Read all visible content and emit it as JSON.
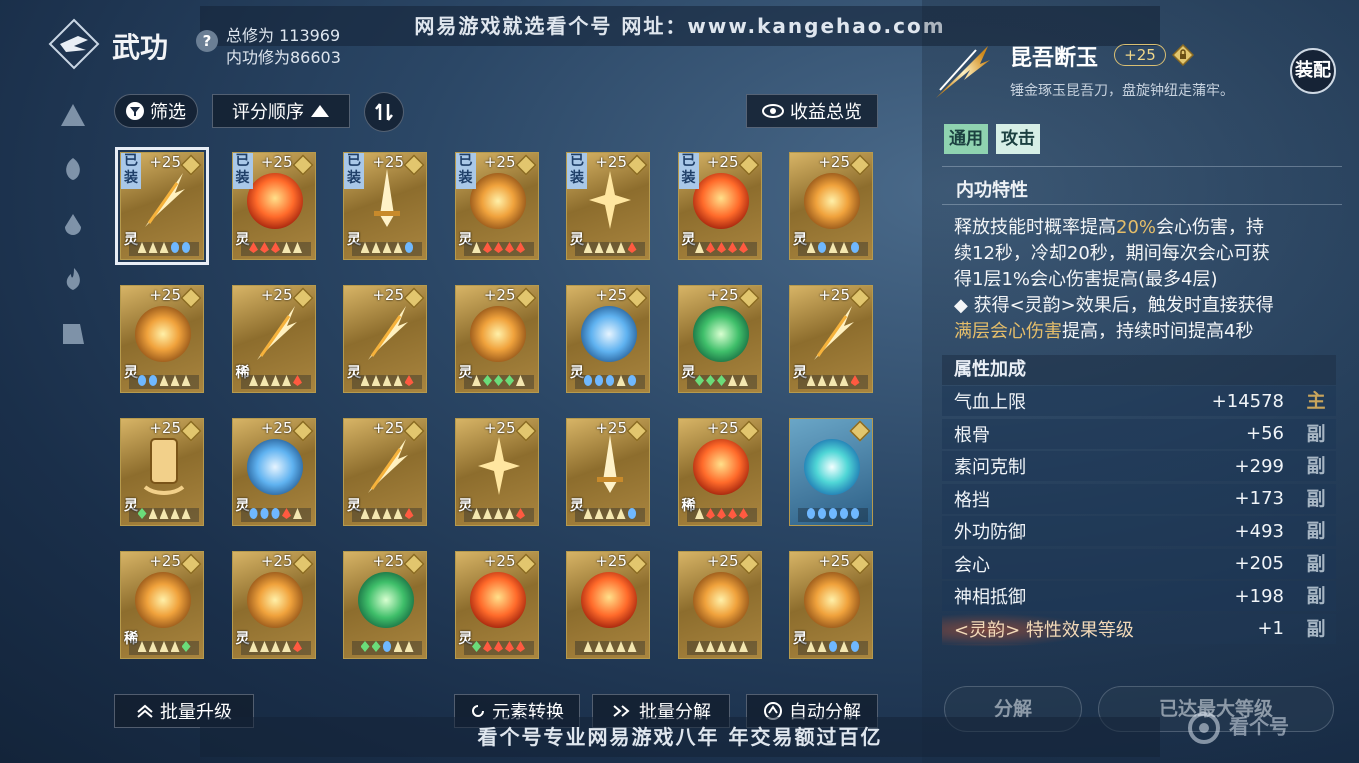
{
  "watermark_top": "网易游戏就选看个号  网址：www.kangehao.com",
  "watermark_bottom": "看个号专业网易游戏八年  年交易额过百亿",
  "header": {
    "title": "武功",
    "help": "?",
    "total_cultivation": "总修为 113969",
    "inner_cultivation": "内功修为86603"
  },
  "toolbar": {
    "filter_label": "筛选",
    "sort_label": "评分顺序",
    "overview_label": "收益总览"
  },
  "bottom_bar": {
    "batch_upgrade": "批量升级",
    "element_convert": "元素转换",
    "batch_disassemble": "批量分解",
    "auto_disassemble": "自动分解"
  },
  "colors": {
    "accent_gold": "#e5be6a",
    "card_gold": "#b69a4d",
    "equipped_badge": "#a9c8e8"
  },
  "cards": [
    {
      "level": "+25",
      "rarity": "灵",
      "equipped": "已装",
      "selected": true,
      "art": "spear",
      "gems": [
        "w",
        "w",
        "w",
        "b",
        "b"
      ]
    },
    {
      "level": "+25",
      "rarity": "灵",
      "equipped": "已装",
      "art": "fire",
      "gems": [
        "r",
        "r",
        "r",
        "w",
        "w"
      ]
    },
    {
      "level": "+25",
      "rarity": "灵",
      "equipped": "已装",
      "art": "sword",
      "gems": [
        "w",
        "w",
        "w",
        "w",
        "b"
      ]
    },
    {
      "level": "+25",
      "rarity": "灵",
      "equipped": "已装",
      "art": "sun",
      "gems": [
        "w",
        "r",
        "r",
        "r",
        "r"
      ]
    },
    {
      "level": "+25",
      "rarity": "灵",
      "equipped": "已装",
      "art": "star",
      "gems": [
        "w",
        "w",
        "w",
        "w",
        "r"
      ]
    },
    {
      "level": "+25",
      "rarity": "灵",
      "equipped": "已装",
      "art": "fire",
      "gems": [
        "w",
        "r",
        "r",
        "r",
        "r"
      ]
    },
    {
      "level": "+25",
      "rarity": "灵",
      "equipped": "",
      "art": "sun",
      "gems": [
        "w",
        "b",
        "w",
        "w",
        "b"
      ]
    },
    {
      "level": "+25",
      "rarity": "灵",
      "equipped": "",
      "art": "sun",
      "gems": [
        "b",
        "b",
        "w",
        "w",
        "w"
      ]
    },
    {
      "level": "+25",
      "rarity": "稀",
      "equipped": "",
      "art": "spear",
      "gems": [
        "w",
        "w",
        "w",
        "w",
        "r"
      ]
    },
    {
      "level": "+25",
      "rarity": "灵",
      "equipped": "",
      "art": "spear",
      "gems": [
        "w",
        "w",
        "w",
        "w",
        "r"
      ]
    },
    {
      "level": "+25",
      "rarity": "灵",
      "equipped": "",
      "art": "sun",
      "gems": [
        "w",
        "g",
        "g",
        "g",
        "w"
      ]
    },
    {
      "level": "+25",
      "rarity": "灵",
      "equipped": "",
      "art": "water",
      "gems": [
        "b",
        "b",
        "b",
        "w",
        "b"
      ]
    },
    {
      "level": "+25",
      "rarity": "灵",
      "equipped": "",
      "art": "jade",
      "gems": [
        "g",
        "g",
        "g",
        "w",
        "w"
      ]
    },
    {
      "level": "+25",
      "rarity": "灵",
      "equipped": "",
      "art": "spear",
      "gems": [
        "w",
        "w",
        "w",
        "w",
        "r"
      ]
    },
    {
      "level": "+25",
      "rarity": "灵",
      "equipped": "",
      "art": "bell",
      "gems": [
        "g",
        "w",
        "w",
        "w",
        "w"
      ]
    },
    {
      "level": "+25",
      "rarity": "灵",
      "equipped": "",
      "art": "water",
      "gems": [
        "b",
        "b",
        "b",
        "r",
        "w"
      ]
    },
    {
      "level": "+25",
      "rarity": "灵",
      "equipped": "",
      "art": "spear",
      "gems": [
        "w",
        "w",
        "w",
        "w",
        "r"
      ]
    },
    {
      "level": "+25",
      "rarity": "灵",
      "equipped": "",
      "art": "star",
      "gems": [
        "w",
        "w",
        "w",
        "w",
        "r"
      ]
    },
    {
      "level": "+25",
      "rarity": "灵",
      "equipped": "",
      "art": "sword",
      "gems": [
        "w",
        "w",
        "w",
        "w",
        "b"
      ]
    },
    {
      "level": "+25",
      "rarity": "稀",
      "equipped": "",
      "art": "fire",
      "gems": [
        "w",
        "r",
        "r",
        "r",
        "r"
      ]
    },
    {
      "level": "",
      "rarity": "",
      "equipped": "",
      "art": "wave",
      "gems": [
        "b",
        "b",
        "b",
        "b",
        "b"
      ]
    },
    {
      "level": "+25",
      "rarity": "稀",
      "equipped": "",
      "art": "sun",
      "gems": [
        "w",
        "w",
        "w",
        "w",
        "g"
      ]
    },
    {
      "level": "+25",
      "rarity": "灵",
      "equipped": "",
      "art": "sun",
      "gems": [
        "w",
        "w",
        "w",
        "w",
        "r"
      ]
    },
    {
      "level": "+25",
      "rarity": "",
      "equipped": "",
      "art": "jade",
      "gems": [
        "g",
        "g",
        "b",
        "w",
        "w"
      ]
    },
    {
      "level": "+25",
      "rarity": "灵",
      "equipped": "",
      "art": "fire",
      "gems": [
        "g",
        "r",
        "r",
        "r",
        "r"
      ]
    },
    {
      "level": "+25",
      "rarity": "",
      "equipped": "",
      "art": "fire",
      "gems": [
        "w",
        "w",
        "w",
        "w",
        "w"
      ]
    },
    {
      "level": "+25",
      "rarity": "",
      "equipped": "",
      "art": "sun",
      "gems": [
        "w",
        "w",
        "w",
        "w",
        "w"
      ]
    },
    {
      "level": "+25",
      "rarity": "灵",
      "equipped": "",
      "art": "sun",
      "gems": [
        "w",
        "w",
        "b",
        "w",
        "b"
      ]
    }
  ],
  "detail": {
    "name": "昆吾断玉",
    "level": "+25",
    "description": "锤金琢玉昆吾刀，盘旋钟纽走蒲牢。",
    "equip_label": "装配",
    "tags": [
      "通用",
      "攻击"
    ],
    "trait_title": "内功特性",
    "trait_lines": [
      [
        "释放技能时概率提高",
        "20%",
        "会心伤害，持"
      ],
      [
        "续12秒，冷却20秒，期间每次会心可获"
      ],
      [
        "得1层1%会心伤害提高(最多4层)"
      ],
      [
        "◆ 获得<灵韵>效果后，触发时直接获得"
      ],
      [
        "",
        "满层会心伤害",
        "提高，持续时间提高4秒"
      ]
    ],
    "attr_title": "属性加成",
    "attributes": [
      {
        "name": "气血上限",
        "value": "+14578",
        "kind": "主",
        "main": true
      },
      {
        "name": "根骨",
        "value": "+56",
        "kind": "副"
      },
      {
        "name": "素问克制",
        "value": "+299",
        "kind": "副"
      },
      {
        "name": "格挡",
        "value": "+173",
        "kind": "副"
      },
      {
        "name": "外功防御",
        "value": "+493",
        "kind": "副"
      },
      {
        "name": "会心",
        "value": "+205",
        "kind": "副"
      },
      {
        "name": "神相抵御",
        "value": "+198",
        "kind": "副"
      },
      {
        "name": "<灵韵> 特性效果等级",
        "value": "+1",
        "kind": "副",
        "special": true
      }
    ],
    "disassemble_label": "分解",
    "max_level_label": "已达最大等级"
  },
  "logo_text": "看个号"
}
